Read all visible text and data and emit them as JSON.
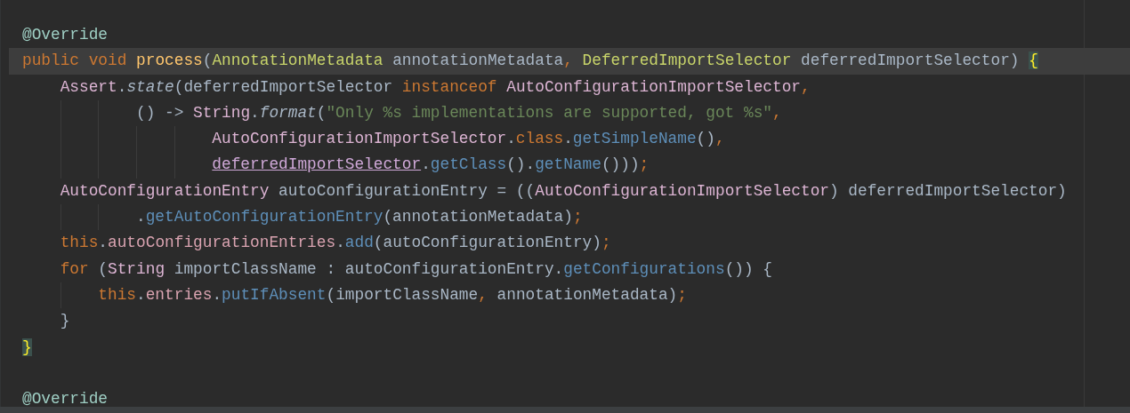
{
  "editor": {
    "lines": [
      {
        "kind": "code",
        "current": false,
        "tokens": [
          {
            "kind": "annotation",
            "text": "@Override"
          }
        ]
      },
      {
        "kind": "code",
        "current": true,
        "tokens": [
          {
            "kind": "keyword",
            "text": "public "
          },
          {
            "kind": "keyword",
            "text": "void "
          },
          {
            "kind": "declaration",
            "text": "process"
          },
          {
            "kind": "plain",
            "text": "("
          },
          {
            "kind": "type",
            "text": "AnnotationMetadata"
          },
          {
            "kind": "plain",
            "text": " annotationMetadata"
          },
          {
            "kind": "punct",
            "text": ", "
          },
          {
            "kind": "type",
            "text": "DeferredImportSelector"
          },
          {
            "kind": "plain",
            "text": " deferredImportSelector) "
          },
          {
            "kind": "brace-match",
            "text": "{"
          }
        ],
        "children": [
          {
            "kind": "code",
            "current": false,
            "tokens": [
              {
                "kind": "class",
                "text": "Assert"
              },
              {
                "kind": "plain",
                "text": "."
              },
              {
                "kind": "static-call",
                "text": "state"
              },
              {
                "kind": "plain",
                "text": "(deferredImportSelector "
              },
              {
                "kind": "keyword",
                "text": "instanceof "
              },
              {
                "kind": "class",
                "text": "AutoConfigurationImportSelector"
              },
              {
                "kind": "punct",
                "text": ","
              }
            ],
            "children": [
              {
                "kind": "continuation",
                "current": false,
                "tokens": [
                  {
                    "kind": "plain",
                    "text": "() -> "
                  },
                  {
                    "kind": "class",
                    "text": "String"
                  },
                  {
                    "kind": "plain",
                    "text": "."
                  },
                  {
                    "kind": "static-call",
                    "text": "format"
                  },
                  {
                    "kind": "plain",
                    "text": "("
                  },
                  {
                    "kind": "string",
                    "text": "\"Only %s implementations are supported, got %s\""
                  },
                  {
                    "kind": "punct",
                    "text": ","
                  }
                ],
                "children": [
                  {
                    "kind": "continuation",
                    "current": false,
                    "tokens": [
                      {
                        "kind": "class",
                        "text": "AutoConfigurationImportSelector"
                      },
                      {
                        "kind": "plain",
                        "text": "."
                      },
                      {
                        "kind": "keyword",
                        "text": "class"
                      },
                      {
                        "kind": "plain",
                        "text": "."
                      },
                      {
                        "kind": "call",
                        "text": "getSimpleName"
                      },
                      {
                        "kind": "plain",
                        "text": "()"
                      },
                      {
                        "kind": "punct",
                        "text": ","
                      }
                    ]
                  },
                  {
                    "kind": "continuation",
                    "current": false,
                    "tokens": [
                      {
                        "kind": "captured",
                        "text": "deferredImportSelector"
                      },
                      {
                        "kind": "plain",
                        "text": "."
                      },
                      {
                        "kind": "call",
                        "text": "getClass"
                      },
                      {
                        "kind": "plain",
                        "text": "()."
                      },
                      {
                        "kind": "call",
                        "text": "getName"
                      },
                      {
                        "kind": "plain",
                        "text": "()))"
                      },
                      {
                        "kind": "punct",
                        "text": ";"
                      }
                    ]
                  }
                ]
              }
            ]
          },
          {
            "kind": "code",
            "current": false,
            "tokens": [
              {
                "kind": "class",
                "text": "AutoConfigurationEntry"
              },
              {
                "kind": "plain",
                "text": " autoConfigurationEntry = (("
              },
              {
                "kind": "class",
                "text": "AutoConfigurationImportSelector"
              },
              {
                "kind": "plain",
                "text": ") deferredImportSelector)"
              }
            ],
            "children": [
              {
                "kind": "continuation",
                "current": false,
                "tokens": [
                  {
                    "kind": "plain",
                    "text": "."
                  },
                  {
                    "kind": "call",
                    "text": "getAutoConfigurationEntry"
                  },
                  {
                    "kind": "plain",
                    "text": "(annotationMetadata)"
                  },
                  {
                    "kind": "punct",
                    "text": ";"
                  }
                ]
              }
            ]
          },
          {
            "kind": "code",
            "current": false,
            "tokens": [
              {
                "kind": "keyword",
                "text": "this"
              },
              {
                "kind": "plain",
                "text": "."
              },
              {
                "kind": "field",
                "text": "autoConfigurationEntries"
              },
              {
                "kind": "plain",
                "text": "."
              },
              {
                "kind": "call",
                "text": "add"
              },
              {
                "kind": "plain",
                "text": "(autoConfigurationEntry)"
              },
              {
                "kind": "punct",
                "text": ";"
              }
            ]
          },
          {
            "kind": "code",
            "current": false,
            "tokens": [
              {
                "kind": "keyword",
                "text": "for"
              },
              {
                "kind": "plain",
                "text": " ("
              },
              {
                "kind": "class",
                "text": "String"
              },
              {
                "kind": "plain",
                "text": " importClassName : autoConfigurationEntry."
              },
              {
                "kind": "call",
                "text": "getConfigurations"
              },
              {
                "kind": "plain",
                "text": "()) {"
              }
            ],
            "children": [
              {
                "kind": "code",
                "current": false,
                "tokens": [
                  {
                    "kind": "keyword",
                    "text": "this"
                  },
                  {
                    "kind": "plain",
                    "text": "."
                  },
                  {
                    "kind": "field",
                    "text": "entries"
                  },
                  {
                    "kind": "plain",
                    "text": "."
                  },
                  {
                    "kind": "call",
                    "text": "putIfAbsent"
                  },
                  {
                    "kind": "plain",
                    "text": "(importClassName"
                  },
                  {
                    "kind": "punct",
                    "text": ", "
                  },
                  {
                    "kind": "plain",
                    "text": "annotationMetadata)"
                  },
                  {
                    "kind": "punct",
                    "text": ";"
                  }
                ]
              }
            ]
          },
          {
            "kind": "code",
            "current": false,
            "tokens": [
              {
                "kind": "plain",
                "text": "}"
              }
            ]
          }
        ]
      },
      {
        "kind": "code",
        "current": false,
        "tokens": [
          {
            "kind": "brace-match",
            "text": "}"
          }
        ]
      },
      {
        "kind": "blank"
      },
      {
        "kind": "code",
        "current": false,
        "tokens": [
          {
            "kind": "annotation",
            "text": "@Override"
          }
        ]
      }
    ]
  }
}
